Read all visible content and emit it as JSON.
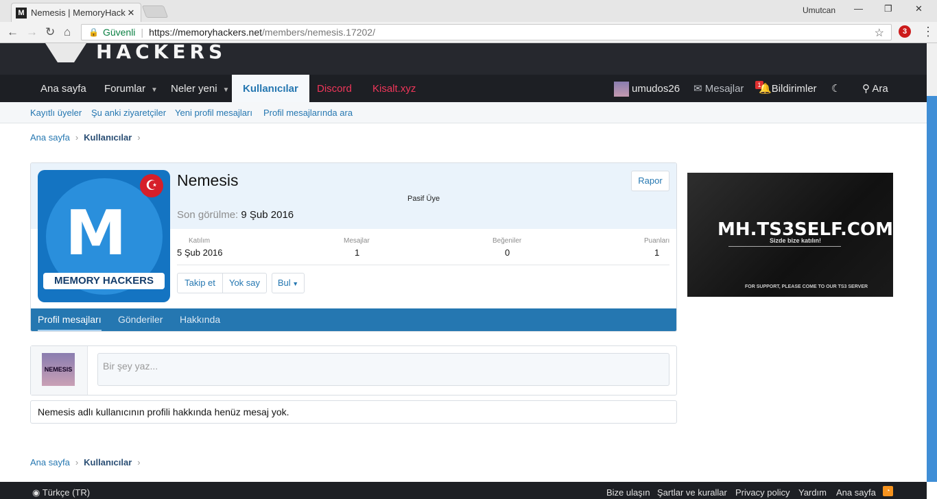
{
  "browser": {
    "tab_title": "Nemesis | MemoryHacke",
    "tab_favicon": "M",
    "close_glyph": "✕",
    "user": "Umutcan",
    "secure_label": "Güvenli",
    "url_host": "https://memoryhackers.net",
    "url_path": "/members/nemesis.17202/",
    "ext_badge": "3"
  },
  "site": {
    "logo_text": "HACKERS",
    "nav": {
      "home": "Ana sayfa",
      "forums": "Forumlar",
      "whats_new": "Neler yeni",
      "members": "Kullanıcılar",
      "discord": "Discord",
      "kisalt": "Kisalt.xyz",
      "username": "umudos26",
      "messages": "Mesajlar",
      "alerts": "Bildirimler",
      "alerts_count": "1",
      "search": "Ara"
    },
    "subnav": [
      "Kayıtlı üyeler",
      "Şu anki ziyaretçiler",
      "Yeni profil mesajları",
      "Profil mesajlarında ara"
    ]
  },
  "breadcrumb": {
    "home": "Ana sayfa",
    "current": "Kullanıcılar",
    "sep": "›"
  },
  "profile": {
    "avatar_text": "MEMORY HACKERS",
    "name": "Nemesis",
    "role": "Pasif Üye",
    "seen_label": "Son görülme:",
    "seen_value": "9 Şub 2016",
    "report": "Rapor",
    "stats": [
      {
        "label": "Katılım",
        "value": "5 Şub 2016"
      },
      {
        "label": "Mesajlar",
        "value": "1"
      },
      {
        "label": "Beğeniler",
        "value": "0"
      },
      {
        "label": "Puanları",
        "value": "1"
      }
    ],
    "buttons": {
      "follow": "Takip et",
      "ignore": "Yok say",
      "find": "Bul"
    },
    "tabs": [
      "Profil mesajları",
      "Gönderiler",
      "Hakkında"
    ]
  },
  "post": {
    "avatar_text": "NEMESIS",
    "placeholder": "Bir şey yaz...",
    "empty_text": "Nemesis adlı kullanıcının profili hakkında henüz mesaj yok."
  },
  "ad": {
    "title": "MH.TS3SELF.COM",
    "subtitle": "Sizde bize katılın!",
    "support": "FOR SUPPORT, PLEASE COME TO OUR TS3 SERVER"
  },
  "footer": {
    "language": "Türkçe (TR)",
    "links": [
      "Bize ulaşın",
      "Şartlar ve kurallar",
      "Privacy policy",
      "Yardım",
      "Ana sayfa"
    ]
  }
}
